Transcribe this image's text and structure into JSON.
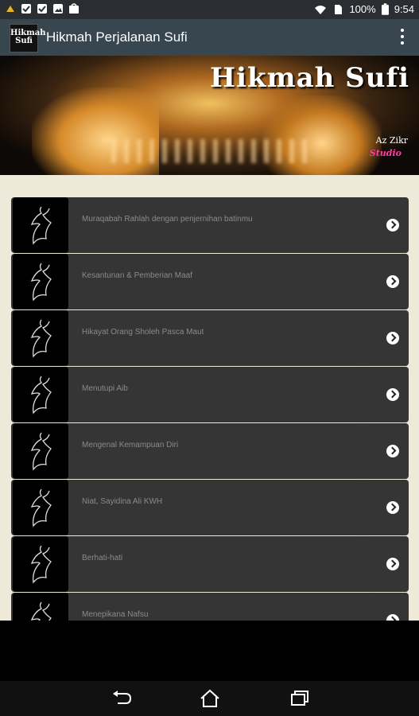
{
  "status_bar": {
    "battery": "100%",
    "time": "9:54",
    "icons": [
      "notification-icon",
      "checkbox-icon",
      "checkbox-icon",
      "image-icon",
      "shop-icon",
      "wifi-icon",
      "sim-icon",
      "battery-icon"
    ]
  },
  "app_bar": {
    "icon_text_line1": "Hikmah",
    "icon_text_line2": "Sufi",
    "title": "Hikmah Perjalanan Sufi",
    "overflow_icon": "more-vertical-icon"
  },
  "banner": {
    "title": "Hikmah Sufi",
    "subtitle": "Az Zikr",
    "subtitle2": "Studio"
  },
  "list": {
    "items": [
      {
        "label": "Muraqabah Rahlah dengan penjernihan batinmu"
      },
      {
        "label": "Kesantunan & Pemberian Maaf"
      },
      {
        "label": "Hikayat Orang Sholeh Pasca Maut"
      },
      {
        "label": "Menutupi Aib"
      },
      {
        "label": "Mengenal Kemampuan Diri"
      },
      {
        "label": "Niat, Sayidina Ali KWH"
      },
      {
        "label": "Berhati-hati"
      },
      {
        "label": "Menepikana Nafsu"
      }
    ]
  },
  "nav": {
    "back": "back-icon",
    "home": "home-icon",
    "recents": "recents-icon"
  }
}
